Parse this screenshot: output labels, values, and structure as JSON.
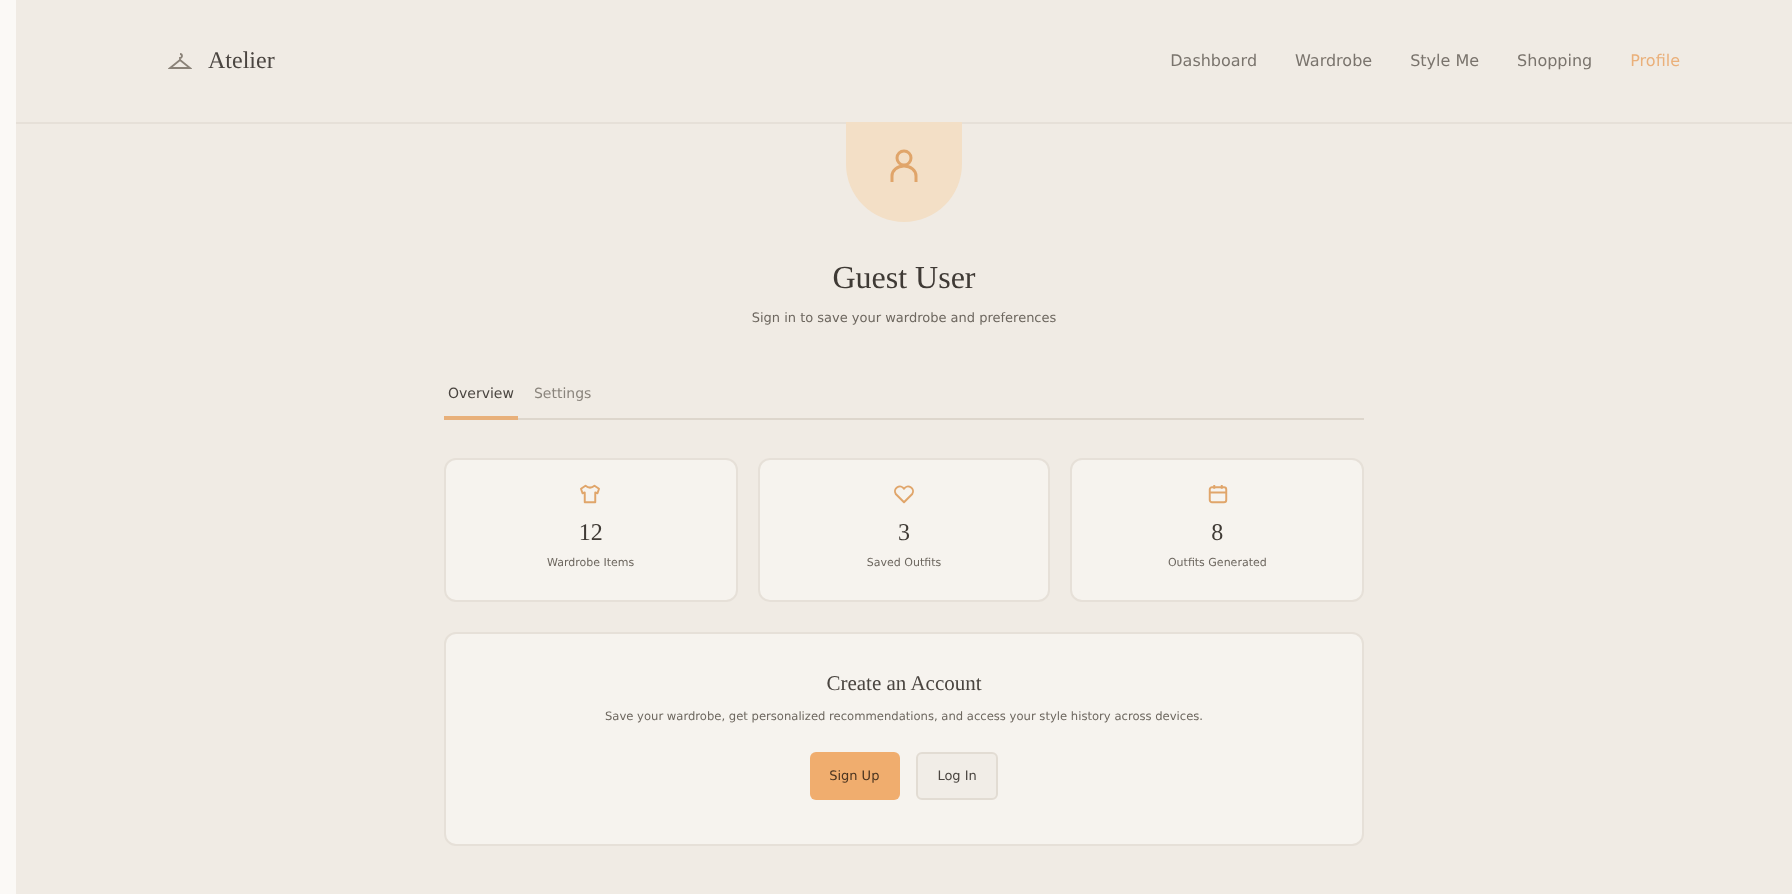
{
  "brand": {
    "name": "Atelier"
  },
  "nav": [
    {
      "label": "Dashboard",
      "selected": false
    },
    {
      "label": "Wardrobe",
      "selected": false
    },
    {
      "label": "Style Me",
      "selected": false
    },
    {
      "label": "Shopping",
      "selected": false
    },
    {
      "label": "Profile",
      "selected": true
    }
  ],
  "profile": {
    "name": "Guest User",
    "subtitle": "Sign in to save your wardrobe and preferences"
  },
  "tabs": [
    {
      "label": "Overview",
      "selected": true
    },
    {
      "label": "Settings",
      "selected": false
    }
  ],
  "stats": [
    {
      "kind": "shirt",
      "value": "12",
      "label": "Wardrobe Items"
    },
    {
      "kind": "heart",
      "value": "3",
      "label": "Saved Outfits"
    },
    {
      "kind": "calendar",
      "value": "8",
      "label": "Outfits Generated"
    }
  ],
  "account": {
    "title": "Create an Account",
    "text": "Save your wardrobe, get personalized recommendations, and access your style history across devices.",
    "buttons": [
      {
        "label": "Sign Up",
        "kind": "primary"
      },
      {
        "label": "Log In",
        "kind": "secondary"
      }
    ]
  }
}
